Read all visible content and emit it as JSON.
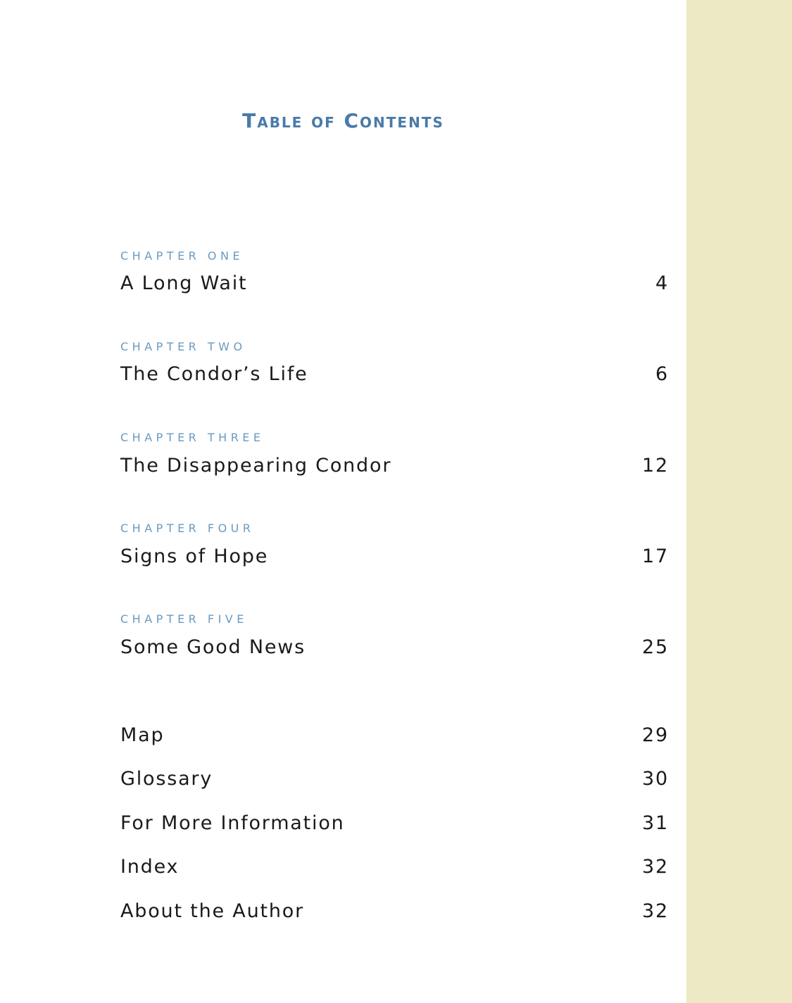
{
  "title": "Table of Contents",
  "colors": {
    "title": "#4a7aa8",
    "chapter_label": "#6a9ac0",
    "side_band": "#ede9c4"
  },
  "chapters": [
    {
      "label": "CHAPTER ONE",
      "title": "A Long Wait",
      "page": "4"
    },
    {
      "label": "CHAPTER TWO",
      "title": "The Condor’s Life",
      "page": "6"
    },
    {
      "label": "CHAPTER THREE",
      "title": "The Disappearing Condor",
      "page": "12"
    },
    {
      "label": "CHAPTER FOUR",
      "title": "Signs of Hope",
      "page": "17"
    },
    {
      "label": "CHAPTER FIVE",
      "title": "Some Good News",
      "page": "25"
    }
  ],
  "back_matter": [
    {
      "title": "Map",
      "page": "29"
    },
    {
      "title": "Glossary",
      "page": "30"
    },
    {
      "title": "For More Information",
      "page": "31"
    },
    {
      "title": "Index",
      "page": "32"
    },
    {
      "title": "About the Author",
      "page": "32"
    }
  ]
}
